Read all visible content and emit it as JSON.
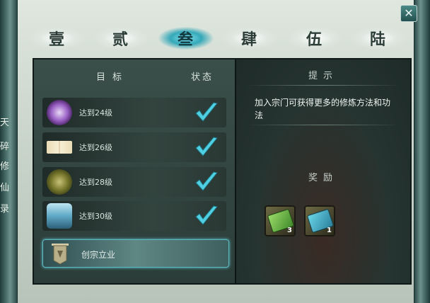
{
  "window": {
    "side_scroll_text": [
      "天",
      "碎",
      "修",
      "仙",
      "录"
    ]
  },
  "tabs": [
    {
      "label": "壹",
      "active": false
    },
    {
      "label": "贰",
      "active": false
    },
    {
      "label": "叁",
      "active": true
    },
    {
      "label": "肆",
      "active": false
    },
    {
      "label": "伍",
      "active": false
    },
    {
      "label": "陆",
      "active": false
    }
  ],
  "goals": {
    "header_target": "目标",
    "header_status": "状态",
    "items": [
      {
        "label": "达到24级",
        "icon": "taiji-icon",
        "completed": true
      },
      {
        "label": "达到26级",
        "icon": "book-icon",
        "completed": true
      },
      {
        "label": "达到28级",
        "icon": "jade-icon",
        "completed": true
      },
      {
        "label": "达到30级",
        "icon": "armor-icon",
        "completed": true
      }
    ],
    "found_sect_label": "创宗立业"
  },
  "tip": {
    "title": "提示",
    "text": "加入宗门可获得更多的修炼方法和功法"
  },
  "rewards": {
    "title": "奖励",
    "items": [
      {
        "icon": "green-ticket-icon",
        "count": "3"
      },
      {
        "icon": "blue-ticket-icon",
        "count": "1"
      }
    ]
  },
  "colors": {
    "accent": "#35a8b8",
    "check": "#4fd0e2"
  }
}
